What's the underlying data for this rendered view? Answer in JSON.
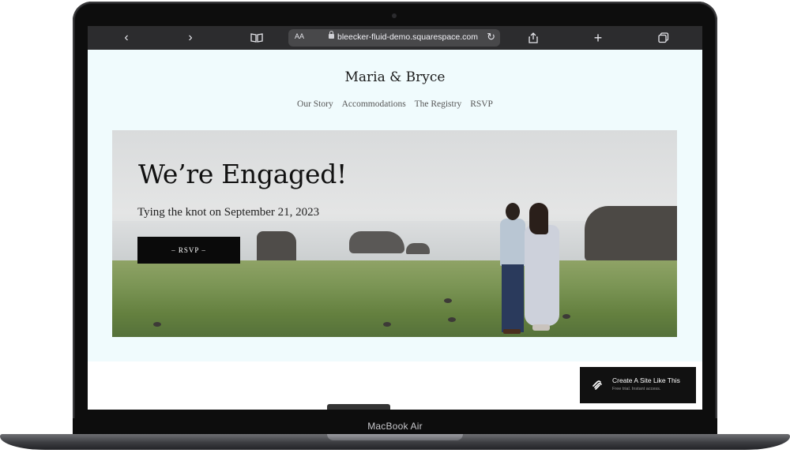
{
  "device": {
    "label": "MacBook Air"
  },
  "browser": {
    "url": "bleecker-fluid-demo.squarespace.com",
    "reader_label": "AA",
    "icons": [
      "back-icon",
      "forward-icon",
      "bookmarks-icon",
      "lock-icon",
      "reload-icon",
      "share-icon",
      "new-tab-icon",
      "tabs-icon"
    ]
  },
  "site": {
    "brand": "Maria & Bryce",
    "nav": [
      "Our Story",
      "Accommodations",
      "The Registry",
      "RSVP"
    ],
    "hero": {
      "title": "We’re Engaged!",
      "subtitle": "Tying the knot on September 21, 2023",
      "button": "– RSVP –"
    },
    "background_color": "#f0fbfd"
  },
  "promo": {
    "title": "Create A Site Like This",
    "subtitle": "Free trial. Instant access."
  }
}
